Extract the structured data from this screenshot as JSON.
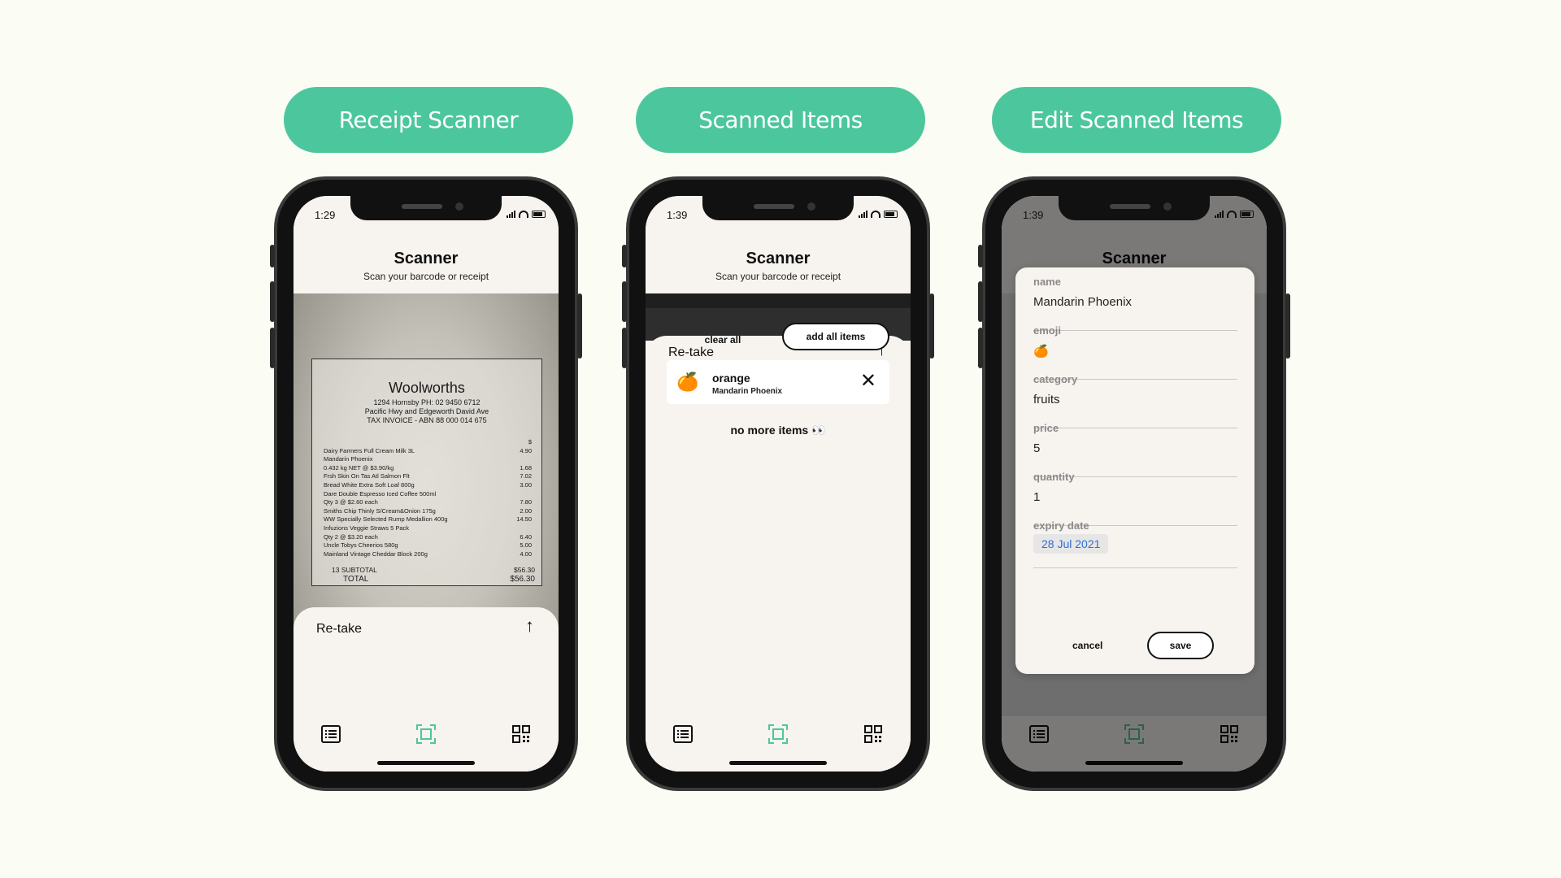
{
  "colors": {
    "accent": "#4cc79d",
    "background": "#fbfcf4",
    "app_bg": "#f7f3ee",
    "date_text": "#2f6fd0"
  },
  "panels": [
    {
      "label": "Receipt Scanner"
    },
    {
      "label": "Scanned Items"
    },
    {
      "label": "Edit Scanned Items"
    }
  ],
  "status": {
    "time1": "1:29",
    "time2": "1:39",
    "time3": "1:39"
  },
  "header": {
    "title": "Scanner",
    "subtitle": "Scan your barcode or receipt"
  },
  "receipt": {
    "store": "Woolworths",
    "address": "1294 Hornsby  PH: 02 9450 6712\nPacific Hwy and Edgeworth David Ave\nTAX INVOICE - ABN 88 000 014 675",
    "lines": [
      {
        "text": "",
        "amount": "$"
      },
      {
        "text": "Dairy Farmers Full Cream Milk 3L",
        "amount": "4.90"
      },
      {
        "text": "Mandarin Phoenix",
        "amount": ""
      },
      {
        "text": "0.432 kg NET @ $3.90/kg",
        "amount": "1.68"
      },
      {
        "text": "Frsh Skin On Tas Atl Salmon Flt",
        "amount": "7.02"
      },
      {
        "text": "Bread White Extra Soft Loaf 800g",
        "amount": "3.00"
      },
      {
        "text": "Dare Double Espresso Iced Coffee 500ml",
        "amount": ""
      },
      {
        "text": "Qty    3 @    $2.60    each",
        "amount": "7.80"
      },
      {
        "text": "Smiths Chip Thinly S/Cream&Onion 175g",
        "amount": "2.00"
      },
      {
        "text": "WW Specially Selected Rump Medallion 400g",
        "amount": "14.50"
      },
      {
        "text": "Infuzions Veggie Straws 5 Pack",
        "amount": ""
      },
      {
        "text": "Qty    2 @    $3.20    each",
        "amount": "6.40"
      },
      {
        "text": "Uncle Tobys Cheerios 580g",
        "amount": "5.00"
      },
      {
        "text": "Mainland Vintage Cheddar Block 200g",
        "amount": "4.00"
      }
    ],
    "subtotal_label": "13 SUBTOTAL",
    "subtotal": "$56.30",
    "total_label": "TOTAL",
    "total": "$56.30"
  },
  "sheet": {
    "retake": "Re-take",
    "arrow": "↑"
  },
  "scanned": {
    "clear_all": "clear all",
    "add_all": "add all items",
    "item": {
      "emoji": "🍊",
      "name": "orange",
      "brand": "Mandarin Phoenix",
      "remove": "✕"
    },
    "no_more": "no more items 👀"
  },
  "edit": {
    "fields": [
      {
        "label": "name",
        "value": "Mandarin Phoenix"
      },
      {
        "label": "emoji",
        "value": "🍊"
      },
      {
        "label": "category",
        "value": "fruits"
      },
      {
        "label": "price",
        "value": "5"
      },
      {
        "label": "quantity",
        "value": "1"
      }
    ],
    "expiry": {
      "label": "expiry date",
      "value": "28 Jul 2021"
    },
    "cancel": "cancel",
    "save": "save"
  },
  "tabs": {
    "icons": [
      "list-icon",
      "scan-icon",
      "qr-icon"
    ],
    "active": "scan-icon"
  }
}
